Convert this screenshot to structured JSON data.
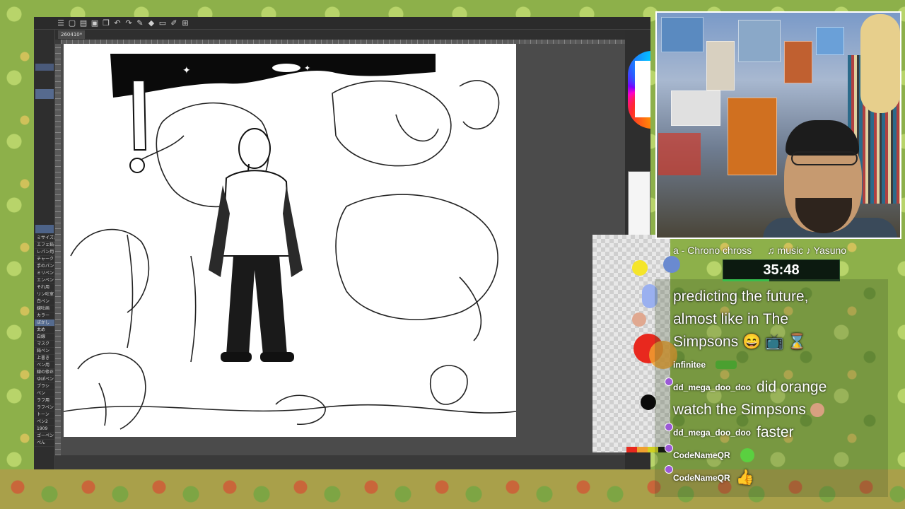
{
  "app": {
    "document_tab": "260410*",
    "toolbar_icons": [
      "menu-icon",
      "new-file-icon",
      "open-icon",
      "save-icon",
      "copy-icon",
      "undo-icon",
      "redo-icon",
      "brush-icon",
      "fill-icon",
      "eraser-icon",
      "pen-icon",
      "ruler-icon"
    ],
    "tools": [
      "ミサイズ用",
      "エフェ鉛筆",
      "レパン用",
      "チャーク",
      "手のパン",
      "ミリペン",
      "エンペン",
      "それ用",
      "リン吐室",
      "白ペン",
      "線吐画",
      "カラー",
      "ぼかし",
      "太め",
      "白線",
      "マスク",
      "鉛ペン",
      "上書き",
      "ペン用",
      "線の修正",
      "ゆぽペン",
      "ブラシ",
      "ペン",
      "ラフ用",
      "ラフペン",
      "トーン",
      "ペン2",
      "1909",
      "ゴーペン",
      "ぺん"
    ]
  },
  "stream": {
    "now_playing_left": "a - Chrono chross",
    "now_playing_right": "♫ music ♪ Yasuno",
    "timer": "35:48",
    "timer_progress": 0.4
  },
  "chat": {
    "lines": [
      {
        "text": "predicting the future,"
      },
      {
        "text": "almost like in The"
      },
      {
        "text": "Simpsons 😄 📺 ⌛"
      }
    ],
    "messages": [
      {
        "user": "infinitee",
        "text": "",
        "emote": "pepe-emote"
      },
      {
        "user": "dd_mega_doo_doo",
        "text": "did orange"
      },
      {
        "user": "",
        "text": "watch the Simpsons",
        "emote": "hand-emote"
      },
      {
        "user": "dd_mega_doo_doo",
        "text": "faster"
      },
      {
        "user": "CodeNameQR",
        "text": "",
        "emote": "green-emote"
      },
      {
        "user": "CodeNameQR",
        "text": "👍"
      }
    ]
  },
  "colors": {
    "accent_green": "#36e35a",
    "timer_bg": "#0c1a10"
  }
}
